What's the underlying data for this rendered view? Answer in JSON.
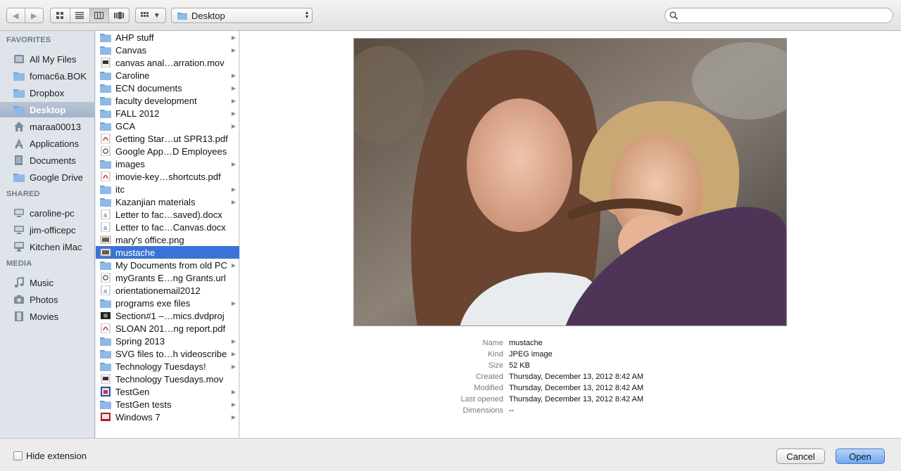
{
  "toolbar": {
    "back_icon": "back-arrow-icon",
    "forward_icon": "forward-arrow-icon",
    "location": "Desktop",
    "search": {
      "value": "",
      "placeholder": ""
    }
  },
  "sidebar": {
    "sections": [
      {
        "title": "FAVORITES",
        "items": [
          {
            "label": "All My Files",
            "icon": "all-files-icon"
          },
          {
            "label": "fomac6a.BOK",
            "icon": "folder-icon"
          },
          {
            "label": "Dropbox",
            "icon": "folder-icon"
          },
          {
            "label": "Desktop",
            "icon": "desktop-folder-icon",
            "selected": true
          },
          {
            "label": "maraa00013",
            "icon": "home-icon"
          },
          {
            "label": "Applications",
            "icon": "applications-icon"
          },
          {
            "label": "Documents",
            "icon": "documents-icon"
          },
          {
            "label": "Google Drive",
            "icon": "folder-icon"
          }
        ]
      },
      {
        "title": "SHARED",
        "items": [
          {
            "label": "caroline-pc",
            "icon": "pc-icon"
          },
          {
            "label": "jim-officepc",
            "icon": "pc-icon"
          },
          {
            "label": "Kitchen iMac",
            "icon": "imac-icon"
          }
        ]
      },
      {
        "title": "MEDIA",
        "items": [
          {
            "label": "Music",
            "icon": "music-icon"
          },
          {
            "label": "Photos",
            "icon": "camera-icon"
          },
          {
            "label": "Movies",
            "icon": "film-icon"
          }
        ]
      }
    ]
  },
  "files": [
    {
      "name": "AHP stuff",
      "icon": "folder-icon",
      "folder": true
    },
    {
      "name": "Canvas",
      "icon": "folder-icon",
      "folder": true
    },
    {
      "name": "canvas anal…arration.mov",
      "icon": "movie-file-icon",
      "folder": false
    },
    {
      "name": "Caroline",
      "icon": "folder-icon",
      "folder": true
    },
    {
      "name": "ECN documents",
      "icon": "folder-icon",
      "folder": true
    },
    {
      "name": "faculty development",
      "icon": "folder-icon",
      "folder": true
    },
    {
      "name": "FALL 2012",
      "icon": "folder-icon",
      "folder": true
    },
    {
      "name": "GCA",
      "icon": "folder-icon",
      "folder": true
    },
    {
      "name": "Getting Star…ut SPR13.pdf",
      "icon": "pdf-file-icon",
      "folder": false
    },
    {
      "name": "Google App…D Employees",
      "icon": "url-file-icon",
      "folder": false
    },
    {
      "name": "images",
      "icon": "folder-icon",
      "folder": true
    },
    {
      "name": "imovie-key…shortcuts.pdf",
      "icon": "pdf-file-icon",
      "folder": false
    },
    {
      "name": "itc",
      "icon": "folder-icon",
      "folder": true
    },
    {
      "name": "Kazanjian materials",
      "icon": "folder-icon",
      "folder": true
    },
    {
      "name": "Letter to fac…saved).docx",
      "icon": "docx-file-icon",
      "folder": false
    },
    {
      "name": "Letter to fac…Canvas.docx",
      "icon": "docx-file-icon",
      "folder": false
    },
    {
      "name": "mary's office.png",
      "icon": "image-file-icon",
      "folder": false
    },
    {
      "name": "mustache",
      "icon": "image-file-icon",
      "folder": false,
      "selected": true
    },
    {
      "name": "My Documents from old PC",
      "icon": "folder-icon",
      "folder": true
    },
    {
      "name": "myGrants E…ng Grants.url",
      "icon": "url-file-icon",
      "folder": false
    },
    {
      "name": "orientationemail2012",
      "icon": "docx-file-icon",
      "folder": false
    },
    {
      "name": "programs exe files",
      "icon": "folder-icon",
      "folder": true
    },
    {
      "name": "Section#1 –…mics.dvdproj",
      "icon": "dvd-project-icon",
      "folder": false
    },
    {
      "name": "SLOAN 201…ng report.pdf",
      "icon": "pdf-file-icon",
      "folder": false
    },
    {
      "name": "Spring 2013",
      "icon": "folder-icon",
      "folder": true
    },
    {
      "name": "SVG files to…h videoscribe",
      "icon": "folder-icon",
      "folder": true
    },
    {
      "name": "Technology Tuesdays!",
      "icon": "folder-icon",
      "folder": true
    },
    {
      "name": "Technology Tuesdays.mov",
      "icon": "movie-file-icon",
      "folder": false
    },
    {
      "name": "TestGen",
      "icon": "app-icon",
      "folder": true
    },
    {
      "name": "TestGen tests",
      "icon": "folder-icon",
      "folder": true
    },
    {
      "name": "Windows 7",
      "icon": "vm-icon",
      "folder": true
    }
  ],
  "preview": {
    "image_subject": "two-women-mustache-photo",
    "info": [
      {
        "label": "Name",
        "value": "mustache"
      },
      {
        "label": "Kind",
        "value": "JPEG image"
      },
      {
        "label": "Size",
        "value": "52 KB"
      },
      {
        "label": "Created",
        "value": "Thursday, December 13, 2012 8:42 AM"
      },
      {
        "label": "Modified",
        "value": "Thursday, December 13, 2012 8:42 AM"
      },
      {
        "label": "Last opened",
        "value": "Thursday, December 13, 2012 8:42 AM"
      },
      {
        "label": "Dimensions",
        "value": "--"
      }
    ]
  },
  "footer": {
    "hide_extension_label": "Hide extension",
    "hide_extension_checked": false,
    "cancel_label": "Cancel",
    "open_label": "Open"
  },
  "colors": {
    "selection_blue": "#3a73d7",
    "sidebar_bg": "#dee4ea",
    "folder_blue": "#8fb9e6"
  }
}
